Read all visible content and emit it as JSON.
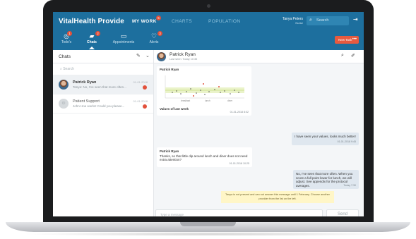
{
  "app": {
    "brand": "VitalHealth Provide",
    "nav": [
      {
        "label": "MY WORK",
        "active": true,
        "badge": "5"
      },
      {
        "label": "CHARTS",
        "active": false
      },
      {
        "label": "POPULATION",
        "active": false
      }
    ],
    "user": {
      "name": "Tanya Peters",
      "role": "Nurse"
    },
    "search_placeholder": "Search",
    "tabs": [
      {
        "label": "Todo's",
        "icon": "check-circle-icon",
        "badge": "1"
      },
      {
        "label": "Chats",
        "icon": "chat-bubbles-icon",
        "badge": "2",
        "active": true
      },
      {
        "label": "Appointments",
        "icon": "calendar-icon"
      },
      {
        "label": "Alerts",
        "icon": "heart-pulse-icon",
        "badge": "3"
      }
    ],
    "new_task_label": "New Task",
    "more_glyph": "•••"
  },
  "chats_panel": {
    "title": "Chats",
    "search_placeholder": "Search",
    "items": [
      {
        "name": "Patrick Ryan",
        "preview": "Tanya: No, I've seen that more often...",
        "date": "01-01-2018",
        "unread": true,
        "selected": true
      },
      {
        "name": "Patient Support",
        "preview": "John Hoe works! Could you please...",
        "date": "01-01-2018",
        "unread": true,
        "selected": false
      }
    ]
  },
  "conversation": {
    "name": "Patrick Ryan",
    "status": "Last seen: Today 10:35",
    "messages": [
      {
        "from": "Patrick Ryan",
        "caption": "Values of last week",
        "time": "01-01-2018 8:02",
        "plot_labels": [
          "breakfast",
          "lunch",
          "diner"
        ]
      },
      {
        "from": "me",
        "text": "I have seen your values, looks much better!",
        "time": "01-01-2018 9:45"
      },
      {
        "from": "Patrick Ryan",
        "text": "Thanks, so that little dip around lunch and diner does not need extra attention?",
        "time": "01-01-2018 10:25"
      },
      {
        "from": "me",
        "text": "No, I've seen that more often. When you score a full point lower for lunch, we will adjust. See appendix for the protocol averages.",
        "time": "Today 7:30"
      }
    ],
    "notice": "Tanya is not present and can not answer this message until 1 February. Choose another provider from the list on the left.",
    "input_placeholder": "Type a message",
    "send_label": "Send"
  },
  "colors": {
    "primary": "#1d6f9e",
    "accent": "#e75a3f",
    "badge": "#e2513b"
  }
}
